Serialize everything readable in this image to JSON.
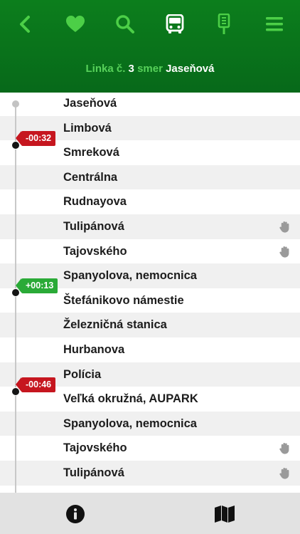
{
  "header": {
    "nav": [
      {
        "name": "back-icon"
      },
      {
        "name": "heart-icon"
      },
      {
        "name": "search-icon"
      },
      {
        "name": "bus-icon",
        "active": true
      },
      {
        "name": "bus-stop-icon"
      },
      {
        "name": "menu-icon"
      }
    ],
    "subtitle": {
      "line_label": "Linka č.",
      "line_number": "3",
      "direction_label": "smer",
      "direction": "Jaseňová"
    }
  },
  "stops": [
    {
      "name": "Jaseňová",
      "request": false
    },
    {
      "name": "Limbová",
      "request": false
    },
    {
      "name": "Smreková",
      "request": false
    },
    {
      "name": "Centrálna",
      "request": false
    },
    {
      "name": "Rudnayova",
      "request": false
    },
    {
      "name": "Tulipánová",
      "request": true
    },
    {
      "name": "Tajovského",
      "request": true
    },
    {
      "name": "Spanyolova, nemocnica",
      "request": false
    },
    {
      "name": "Štefánikovo námestie",
      "request": false
    },
    {
      "name": "Železničná stanica",
      "request": false
    },
    {
      "name": "Hurbanova",
      "request": false
    },
    {
      "name": "Polícia",
      "request": false
    },
    {
      "name": "Veľká okružná, AUPARK",
      "request": false
    },
    {
      "name": "Spanyolova, nemocnica",
      "request": false
    },
    {
      "name": "Tajovského",
      "request": true
    },
    {
      "name": "Tulipánová",
      "request": true
    },
    {
      "name": "",
      "request": false
    }
  ],
  "vehicles": [
    {
      "delay": "-00:32",
      "status": "late",
      "between": [
        1,
        2
      ]
    },
    {
      "delay": "+00:13",
      "status": "early",
      "between": [
        7,
        8
      ]
    },
    {
      "delay": "-00:46",
      "status": "late",
      "between": [
        11,
        12
      ]
    }
  ],
  "colors": {
    "header": "#0c7e1c",
    "icon_green": "#4ccf47",
    "late": "#c6161f",
    "early": "#2aaa37"
  },
  "footer": {
    "buttons": [
      {
        "name": "info-icon"
      },
      {
        "name": "map-icon"
      }
    ]
  }
}
